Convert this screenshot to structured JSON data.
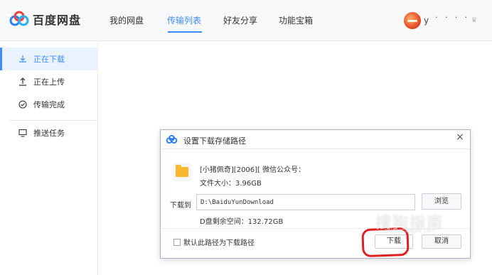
{
  "header": {
    "app_name": "百度网盘",
    "nav": [
      {
        "label": "我的网盘"
      },
      {
        "label": "传输列表"
      },
      {
        "label": "好友分享"
      },
      {
        "label": "功能宝箱"
      }
    ],
    "active_nav": "传输列表",
    "username": "y ˙ ˙ ˙ ˙"
  },
  "sidebar": {
    "items": [
      {
        "label": "正在下载",
        "icon": "download-icon"
      },
      {
        "label": "正在上传",
        "icon": "upload-icon"
      },
      {
        "label": "传输完成",
        "icon": "check-circle-icon"
      },
      {
        "label": "推送任务",
        "icon": "monitor-icon"
      }
    ],
    "active_item": "正在下载"
  },
  "dialog": {
    "title": "设置下载存储路径",
    "close_symbol": "×",
    "file_name": "[小猪佩奇][2006][ 微信公众号：",
    "file_size": "文件大小：3.96GB",
    "download_to_label": "下载到",
    "path": "D:\\BaiduYunDownload",
    "browse_label": "浏览",
    "free_space": "D盘剩余空间：132.72GB",
    "default_path_label": "默认此路径为下载路径",
    "download_label": "下载",
    "cancel_label": "取消"
  },
  "colors": {
    "accent": "#3b8cff",
    "annotation": "#e02020",
    "folder": "#f9b82e"
  },
  "watermark": {
    "text": "搜狗指南",
    "sub": "zhinan.sogou.com"
  }
}
